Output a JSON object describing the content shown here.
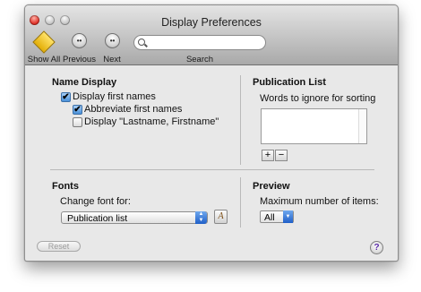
{
  "window": {
    "title": "Display Preferences"
  },
  "toolbar": {
    "show_all": "Show All",
    "previous": "Previous",
    "next": "Next",
    "search_label": "Search",
    "search_placeholder": ""
  },
  "name_display": {
    "heading": "Name Display",
    "display_first_names": "Display first names",
    "abbreviate_first_names": "Abbreviate first names",
    "lastname_firstname": "Display \"Lastname, Firstname\""
  },
  "publication_list": {
    "heading": "Publication List",
    "ignore_label": "Words to ignore for sorting",
    "add_label": "+",
    "remove_label": "−"
  },
  "fonts": {
    "heading": "Fonts",
    "change_label": "Change font for:",
    "selected_target": "Publication list"
  },
  "preview": {
    "heading": "Preview",
    "max_items_label": "Maximum number of items:",
    "selected_max": "All"
  },
  "footer": {
    "reset_label": "Reset",
    "help_label": "?"
  },
  "icons": {
    "close": "close-icon",
    "minimize": "minimize-icon",
    "zoom": "zoom-icon",
    "show_all": "show-all-icon",
    "previous": "previous-icon",
    "next": "next-icon",
    "search": "search-icon",
    "font_picker": "font-picker-icon",
    "help": "help-icon"
  },
  "colors": {
    "accent": "#2e6fd6",
    "close_light": "#e0332a",
    "window_bg": "#e8e8e8"
  }
}
